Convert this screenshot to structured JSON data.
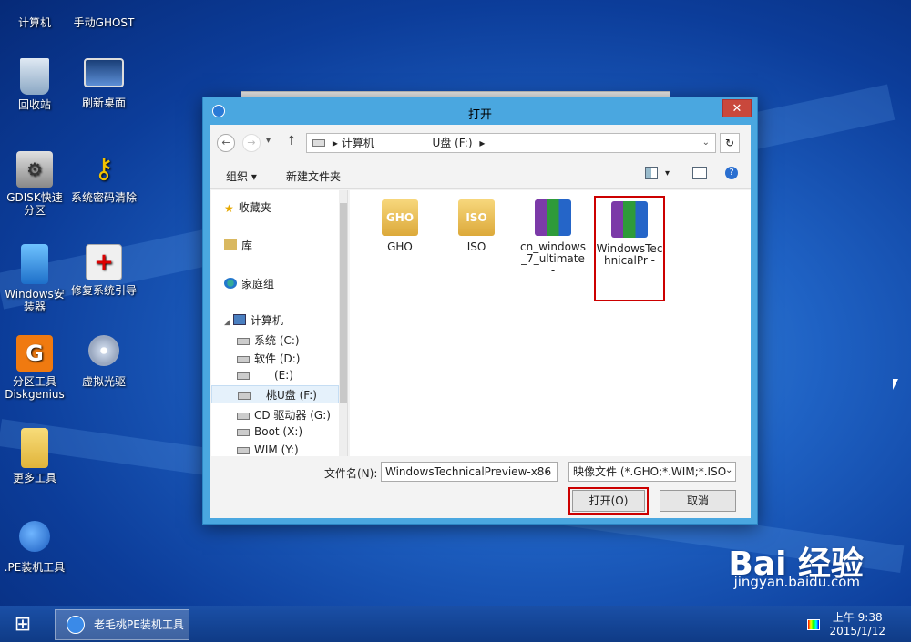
{
  "desktop_icons": [
    {
      "id": "computer",
      "label": "计算机",
      "icon": "computer-icon"
    },
    {
      "id": "manual-ghost",
      "label": "手动GHOST",
      "icon": "ghost-icon"
    },
    {
      "id": "recycle-bin",
      "label": "回收站",
      "icon": "recycle-bin-icon"
    },
    {
      "id": "refresh-desktop",
      "label": "刷新桌面",
      "icon": "refresh-desktop-icon"
    },
    {
      "id": "gdisk",
      "label": "GDISK快速分区",
      "icon": "gdisk-icon"
    },
    {
      "id": "password-clear",
      "label": "系统密码清除",
      "icon": "key-icon"
    },
    {
      "id": "windows-installer",
      "label": "Windows安装器",
      "icon": "windows-installer-icon"
    },
    {
      "id": "repair-boot",
      "label": "修复系统引导",
      "icon": "first-aid-icon"
    },
    {
      "id": "diskgenius",
      "label": "分区工具Diskgenius",
      "icon": "diskgenius-icon"
    },
    {
      "id": "virtual-drive",
      "label": "虚拟光驱",
      "icon": "virtual-drive-icon"
    },
    {
      "id": "more-tools",
      "label": "更多工具",
      "icon": "folder-icon"
    },
    {
      "id": "pe-installer",
      "label": ".PE装机工具",
      "icon": "peach-icon"
    }
  ],
  "dialog": {
    "title": "打开",
    "close_label": "✕",
    "nav": {
      "back": "←",
      "forward": "→",
      "dropdown": "▾",
      "up": "↑",
      "refresh": "↻"
    },
    "address": {
      "crumbs": [
        "计算机",
        "U盘 (F:)"
      ],
      "separator": "▸"
    },
    "toolbar": {
      "organize": "组织 ▾",
      "new_folder": "新建文件夹"
    },
    "nav_pane": {
      "favorites": "收藏夹",
      "libraries": "库",
      "homegroup": "家庭组",
      "computer": "计算机",
      "drives": [
        "系统 (C:)",
        "软件 (D:)",
        "(E:)",
        "桃U盘 (F:)",
        "CD 驱动器 (G:)",
        "Boot (X:)",
        "WIM (Y:)"
      ]
    },
    "files": [
      {
        "name": "GHO",
        "type": "folder",
        "icon_text": "GHO"
      },
      {
        "name": "ISO",
        "type": "folder",
        "icon_text": "ISO"
      },
      {
        "name": "cn_windows_7_ultimate -",
        "type": "archive"
      },
      {
        "name": "WindowsTechnicalPr -",
        "type": "archive",
        "selected": true
      }
    ],
    "filename_label": "文件名(N):",
    "filename_value": "WindowsTechnicalPreview-x86",
    "filetype_value": "映像文件 (*.GHO;*.WIM;*.ISO",
    "open_button": "打开(O)",
    "cancel_button": "取消"
  },
  "taskbar": {
    "start": "⊞",
    "app_label": "老毛桃PE装机工具",
    "time": "上午 9:38",
    "date": "2015/1/12"
  },
  "watermark": {
    "main": "Bai 经验",
    "sub": "jingyan.baidu.com"
  },
  "colors": {
    "desktop_blue": "#1f62c4",
    "dialog_frame": "#4aa7e0",
    "close_red": "#c9483c",
    "highlight_red": "#cc0000"
  }
}
